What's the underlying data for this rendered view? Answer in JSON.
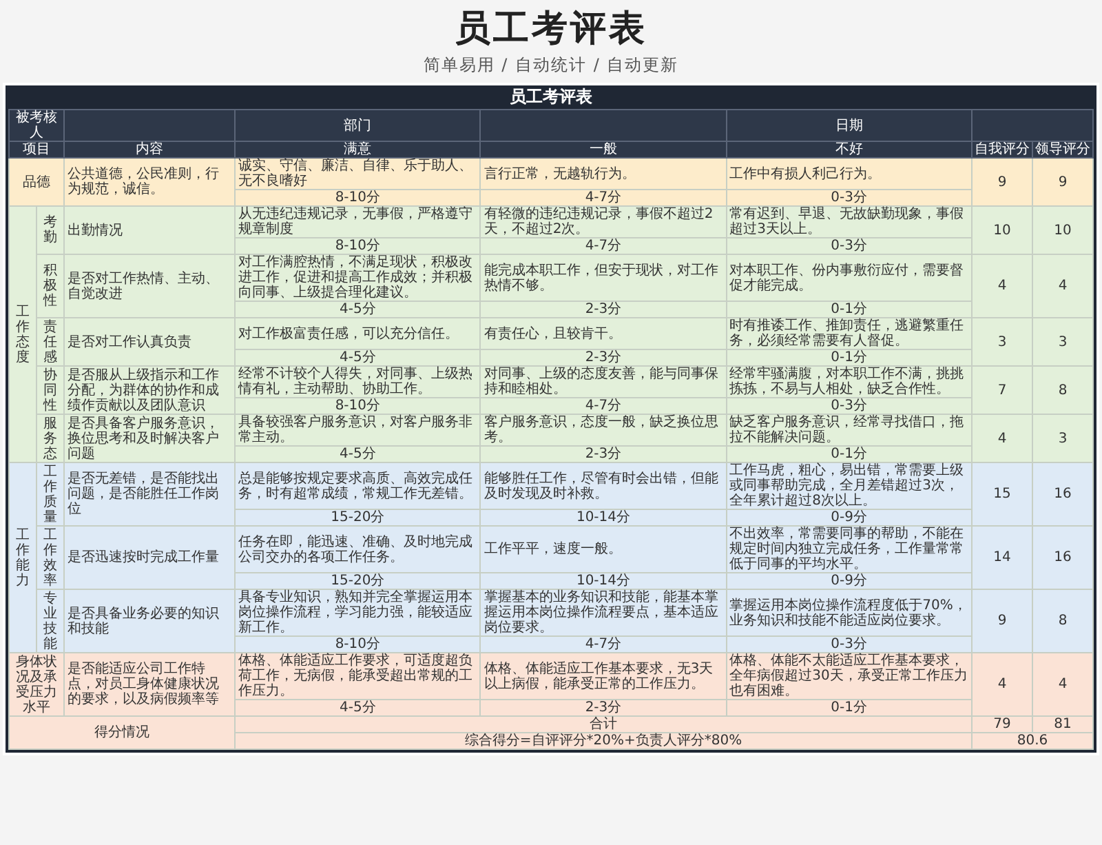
{
  "page": {
    "title": "员工考评表",
    "subtitle": "简单易用 / 自动统计 / 自动更新"
  },
  "sheet": {
    "title": "员工考评表",
    "header": {
      "evaluatee_label": "被考核人",
      "department_label": "部门",
      "date_label": "日期"
    },
    "columns": [
      "项目",
      "内容",
      "满意",
      "一般",
      "不好",
      "自我评分",
      "领导评分"
    ],
    "sections": [
      {
        "kind": "single",
        "color": "#fdeccb",
        "items": [
          {
            "name": "品德",
            "content": "公共道德，公民准则，行为规范，诚信。",
            "criteria": [
              {
                "text": "诚实、守信、廉洁、自律、乐于助人、无不良嗜好",
                "score": "8-10分"
              },
              {
                "text": "言行正常，无越轨行为。",
                "score": "4-7分"
              },
              {
                "text": "工作中有损人利己行为。",
                "score": "0-3分"
              }
            ],
            "self_score": "9",
            "leader_score": "9"
          }
        ]
      },
      {
        "kind": "group",
        "label": "工作态度",
        "color": "#e3f0da",
        "items": [
          {
            "name": "考勤",
            "content": "出勤情况",
            "criteria": [
              {
                "text": "从无违纪违规记录，无事假，严格遵守规章制度",
                "score": "8-10分"
              },
              {
                "text": "有轻微的违纪违规记录，事假不超过2天，不超过2次。",
                "score": "4-7分"
              },
              {
                "text": "常有迟到、早退、无故缺勤现象，事假超过3天以上。",
                "score": "0-3分"
              }
            ],
            "self_score": "10",
            "leader_score": "10"
          },
          {
            "name": "积极性",
            "content": "是否对工作热情、主动、自觉改进",
            "criteria": [
              {
                "text": "对工作满腔热情，不满足现状，积极改进工作，促进和提高工作成效；并积极向同事、上级提合理化建议。",
                "score": "4-5分"
              },
              {
                "text": "能完成本职工作，但安于现状，对工作热情不够。",
                "score": "2-3分"
              },
              {
                "text": "对本职工作、份内事敷衍应付，需要督促才能完成。",
                "score": "0-1分"
              }
            ],
            "self_score": "4",
            "leader_score": "4"
          },
          {
            "name": "责任感",
            "content": "是否对工作认真负责",
            "criteria": [
              {
                "text": "对工作极富责任感，可以充分信任。",
                "score": "4-5分"
              },
              {
                "text": "有责任心，且较肯干。",
                "score": "2-3分"
              },
              {
                "text": "时有推诿工作、推卸责任，逃避繁重任务，必须经常需要有人督促。",
                "score": "0-1分"
              }
            ],
            "self_score": "3",
            "leader_score": "3"
          },
          {
            "name": "协同性",
            "content": "是否服从上级指示和工作分配，为群体的协作和成绩作贡献以及团队意识",
            "criteria": [
              {
                "text": "经常不计较个人得失，对同事、上级热情有礼，主动帮助、协助工作。",
                "score": "8-10分"
              },
              {
                "text": "对同事、上级的态度友善，能与同事保持和睦相处。",
                "score": "4-7分"
              },
              {
                "text": "经常牢骚满腹，对本职工作不满，挑挑拣拣，不易与人相处，缺乏合作性。",
                "score": "0-3分"
              }
            ],
            "self_score": "7",
            "leader_score": "8"
          },
          {
            "name": "服务态",
            "content": "是否具备客户服务意识，换位思考和及时解决客户问题",
            "criteria": [
              {
                "text": "具备较强客户服务意识，对客户服务非常主动。",
                "score": "4-5分"
              },
              {
                "text": "客户服务意识，态度一般，缺乏换位思考。",
                "score": "2-3分"
              },
              {
                "text": "缺乏客户服务意识，经常寻找借口，拖拉不能解决问题。",
                "score": "0-1分"
              }
            ],
            "self_score": "4",
            "leader_score": "3"
          }
        ]
      },
      {
        "kind": "group",
        "label": "工作能力",
        "color": "#deeaf6",
        "items": [
          {
            "name": "工作质量",
            "content": "是否无差错，是否能找出问题，是否能胜任工作岗位",
            "criteria": [
              {
                "text": "总是能够按规定要求高质、高效完成任务，时有超常成绩，常规工作无差错。",
                "score": "15-20分"
              },
              {
                "text": "能够胜任工作，尽管有时会出错，但能及时发现及时补救。",
                "score": "10-14分"
              },
              {
                "text": "工作马虎，粗心，易出错，常需要上级或同事帮助完成，全月差错超过3次，全年累计超过8次以上。",
                "score": "0-9分"
              }
            ],
            "self_score": "15",
            "leader_score": "16"
          },
          {
            "name": "工作效率",
            "content": "是否迅速按时完成工作量",
            "criteria": [
              {
                "text": "任务在即，能迅速、准确、及时地完成公司交办的各项工作任务。",
                "score": "15-20分"
              },
              {
                "text": "工作平平，速度一般。",
                "score": "10-14分"
              },
              {
                "text": "不出效率，常需要同事的帮助，不能在规定时间内独立完成任务，工作量常常低于同事的平均水平。",
                "score": "0-9分"
              }
            ],
            "self_score": "14",
            "leader_score": "16"
          },
          {
            "name": "专业技能",
            "content": "是否具备业务必要的知识和技能",
            "criteria": [
              {
                "text": "具备专业知识，熟知并完全掌握运用本岗位操作流程，学习能力强，能较适应新工作。",
                "score": "8-10分"
              },
              {
                "text": "掌握基本的业务知识和技能，能基本掌握运用本岗位操作流程要点，基本适应岗位要求。",
                "score": "4-7分"
              },
              {
                "text": "掌握运用本岗位操作流程度低于70%，业务知识和技能不能适应岗位要求。",
                "score": "0-3分"
              }
            ],
            "self_score": "9",
            "leader_score": "8"
          }
        ]
      },
      {
        "kind": "single",
        "color": "#fbe3d6",
        "items": [
          {
            "name": "身体状况及承受压力水平",
            "content": "是否能适应公司工作特点，对员工身体健康状况的要求，以及病假频率等",
            "criteria": [
              {
                "text": "体格、体能适应工作要求，可适度超负荷工作，无病假，能承受超出常规的工作压力。",
                "score": "4-5分"
              },
              {
                "text": "体格、体能适应工作基本要求，无3天以上病假，能承受正常的工作压力。",
                "score": "2-3分"
              },
              {
                "text": "体格、体能不太能适应工作基本要求，全年病假超过30天，承受正常工作压力也有困难。",
                "score": "0-1分"
              }
            ],
            "self_score": "4",
            "leader_score": "4"
          }
        ]
      }
    ],
    "footer": {
      "label": "得分情况",
      "total_label": "合计",
      "self_total": "79",
      "leader_total": "81",
      "formula": "综合得分=自评评分*20%+负责人评分*80%",
      "overall": "80.6"
    }
  }
}
